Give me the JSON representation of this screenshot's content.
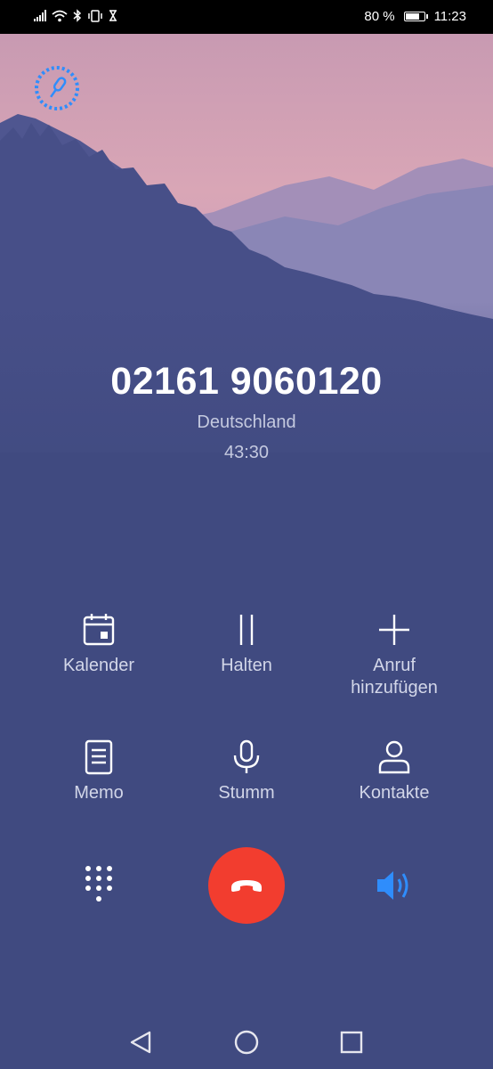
{
  "status_bar": {
    "battery_percent": "80 %",
    "time": "11:23",
    "battery_level": 0.8,
    "icons": [
      "signal-icon",
      "wifi-icon",
      "bluetooth-icon",
      "vibrate-icon",
      "hourglass-icon",
      "battery-icon"
    ]
  },
  "call": {
    "number": "02161 9060120",
    "location": "Deutschland",
    "duration": "43:30"
  },
  "actions": {
    "calendar": {
      "label": "Kalender",
      "icon": "calendar-icon"
    },
    "hold": {
      "label": "Halten",
      "icon": "pause-icon"
    },
    "add_call_line1": "Anruf",
    "add_call_line2": "hinzufügen",
    "add_call_icon": "plus-icon",
    "memo": {
      "label": "Memo",
      "icon": "memo-icon"
    },
    "mute": {
      "label": "Stumm",
      "icon": "microphone-icon"
    },
    "contacts": {
      "label": "Kontakte",
      "icon": "person-icon"
    }
  },
  "controls": {
    "dialpad_icon": "dialpad-icon",
    "end_call_icon": "hang-up-icon",
    "speaker_icon": "speaker-icon",
    "speaker_active": true
  },
  "recording": {
    "icon": "record-icon"
  },
  "colors": {
    "background": "#404a80",
    "end_call": "#f23d2f",
    "speaker_active": "#2f8dfc"
  },
  "nav_bar": {
    "icons": [
      "back-icon",
      "home-icon",
      "recents-icon"
    ]
  }
}
